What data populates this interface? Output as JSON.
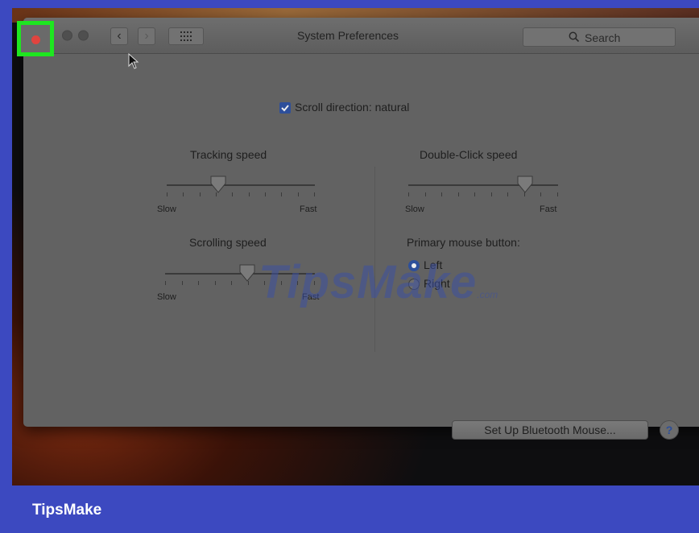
{
  "window": {
    "title": "System Preferences",
    "search_label": "Search"
  },
  "scroll_direction": {
    "label": "Scroll direction: natural",
    "checked": true
  },
  "tracking": {
    "heading": "Tracking speed",
    "min_label": "Slow",
    "max_label": "Fast",
    "value_fraction": 0.35
  },
  "double_click": {
    "heading": "Double-Click speed",
    "min_label": "Slow",
    "max_label": "Fast",
    "value_fraction": 0.78
  },
  "scrolling": {
    "heading": "Scrolling speed",
    "min_label": "Slow",
    "max_label": "Fast",
    "value_fraction": 0.55
  },
  "primary_button": {
    "heading": "Primary mouse button:",
    "options": [
      "Left",
      "Right"
    ],
    "selected": "Left"
  },
  "bluetooth_button": "Set Up Bluetooth Mouse...",
  "help_button": "?",
  "watermark": {
    "text": "TipsMake",
    "suffix": ".com"
  },
  "brand": "TipsMake",
  "colors": {
    "frame": "#3c49c0",
    "highlight": "#1ee620",
    "close": "#e0443f",
    "accent": "#2d4f9b"
  }
}
